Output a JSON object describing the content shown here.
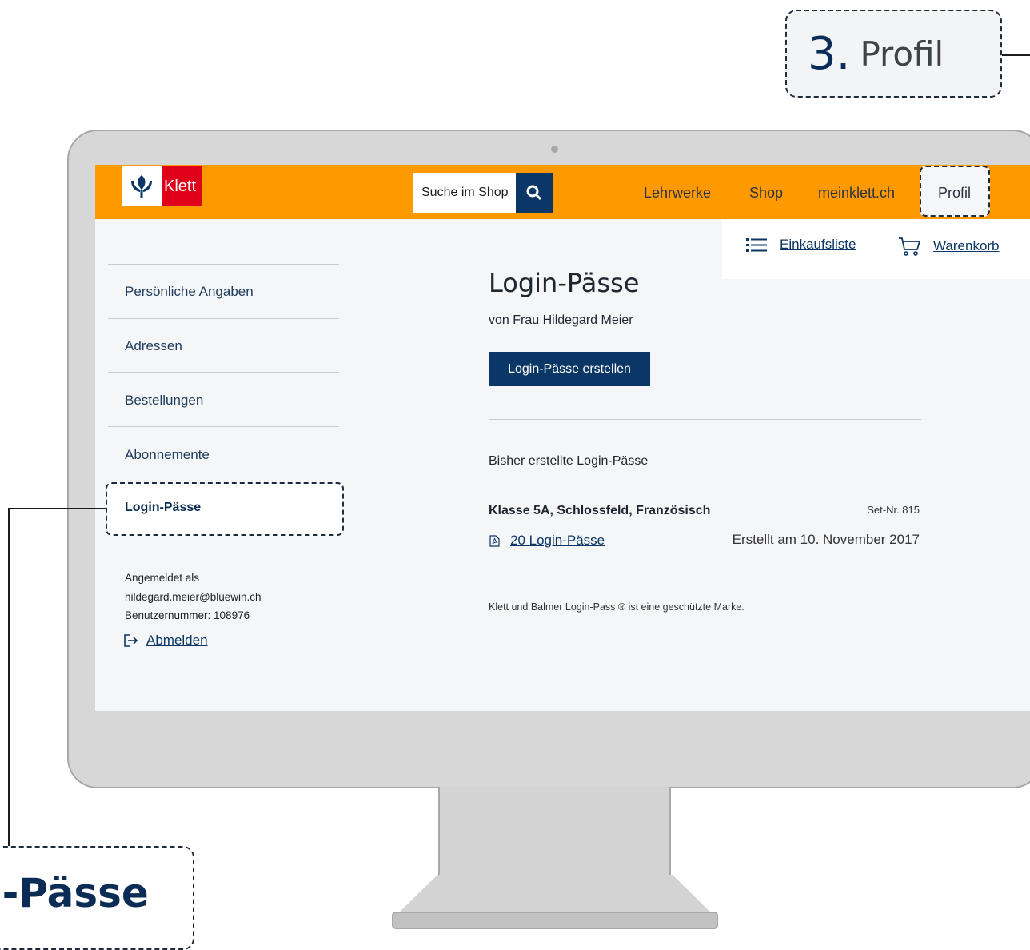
{
  "callouts": {
    "step_number": "3.",
    "step_label": "Profil",
    "zoom_label": "n-Pässe"
  },
  "header": {
    "logo_text": "Klett",
    "search_placeholder": "Suche im Shop",
    "nav": [
      "Lehrwerke",
      "Shop",
      "meinklett.ch",
      "Profil"
    ]
  },
  "utility": {
    "shopping_list": "Einkaufsliste",
    "cart": "Warenkorb"
  },
  "sidebar": {
    "items": [
      "Persönliche Angaben",
      "Adressen",
      "Bestellungen",
      "Abonnemente",
      "Login-Pässe"
    ],
    "active_item": "Login-Pässe",
    "account": {
      "logged_in_as": "Angemeldet als",
      "email": "hildegard.meier@bluewin.ch",
      "user_number": "Benutzernummer: 108976"
    },
    "logout": "Abmelden"
  },
  "main": {
    "title": "Login-Pässe",
    "owner": "von Frau Hildegard Meier",
    "create_button": "Login-Pässe erstellen",
    "list_heading": "Bisher erstellte Login-Pässe",
    "sets": [
      {
        "title": "Klasse 5A, Schlossfeld, Französisch",
        "set_nr": "Set-Nr. 815",
        "link": "20 Login-Pässe",
        "created": "Erstellt am 10. November 2017"
      }
    ],
    "trademark": "Klett und Balmer Login-Pass ® ist eine geschützte Marke."
  },
  "colors": {
    "header_orange": "#ff9900",
    "brand_blue": "#0b3766",
    "klett_red": "#e1001a"
  }
}
